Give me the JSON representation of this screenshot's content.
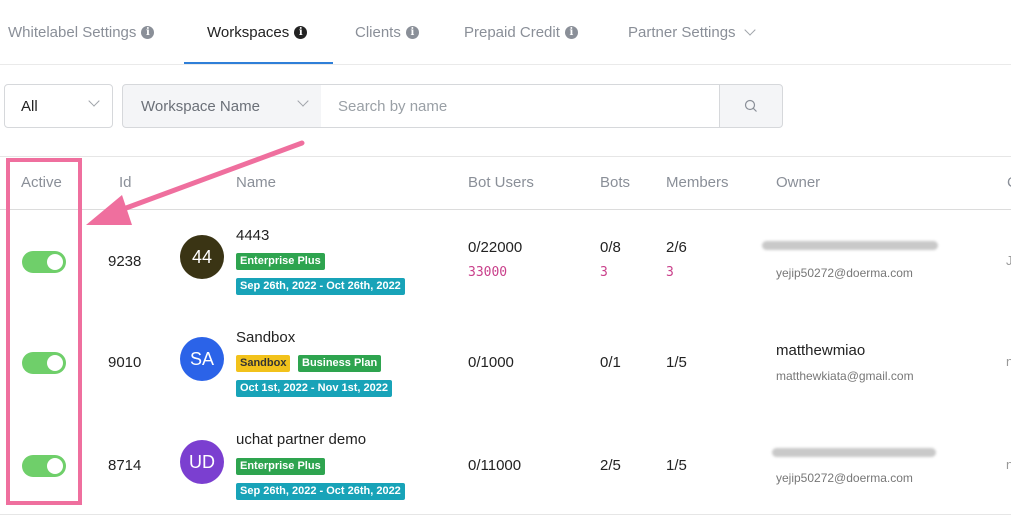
{
  "tabs": [
    {
      "label": "Whitelabel Settings"
    },
    {
      "label": "Workspaces"
    },
    {
      "label": "Clients"
    },
    {
      "label": "Prepaid Credit"
    },
    {
      "label": "Partner Settings"
    }
  ],
  "filters": {
    "status_value": "All",
    "field_value": "Workspace Name",
    "search_placeholder": "Search by name"
  },
  "columns": [
    "Active",
    "Id",
    "Name",
    "Bot Users",
    "Bots",
    "Members",
    "Owner",
    "C"
  ],
  "rows": [
    {
      "active": true,
      "id": "9238",
      "avatar_text": "44",
      "avatar_color": "#3a3414",
      "name": "4443",
      "badges": [
        "Enterprise Plus"
      ],
      "date_range": "Sep 26th, 2022 - Oct 26th, 2022",
      "bot_users": "0/22000",
      "bot_users_extra": "33000",
      "bots": "0/8",
      "bots_extra": "3",
      "members": "2/6",
      "members_extra": "3",
      "owner_email": "yejip50272@doerma.com",
      "last_col": "J"
    },
    {
      "active": true,
      "id": "9010",
      "avatar_text": "SA",
      "avatar_color": "#2b63e8",
      "name": "Sandbox",
      "badges": [
        "Sandbox",
        "Business Plan"
      ],
      "date_range": "Oct 1st, 2022 - Nov 1st, 2022",
      "bot_users": "0/1000",
      "bots": "0/1",
      "members": "1/5",
      "owner_name": "matthewmiao",
      "owner_email": "matthewkiata@gmail.com",
      "last_col": "n"
    },
    {
      "active": true,
      "id": "8714",
      "avatar_text": "UD",
      "avatar_color": "#7b3fd0",
      "name": "uchat partner demo",
      "badges": [
        "Enterprise Plus"
      ],
      "date_range": "Sep 26th, 2022 - Oct 26th, 2022",
      "bot_users": "0/11000",
      "bots": "2/5",
      "members": "1/5",
      "owner_email": "yejip50272@doerma.com",
      "last_col": "n"
    }
  ],
  "colors": {
    "accent": "#2f7fd8",
    "toggle_on": "#6fcf6a",
    "highlight": "#ef6f9e"
  }
}
